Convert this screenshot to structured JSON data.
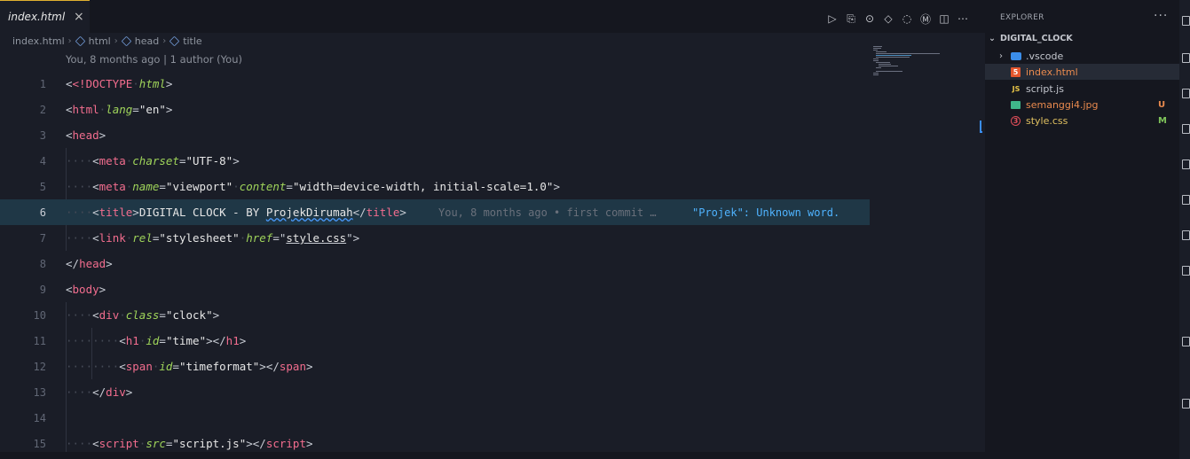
{
  "tab": {
    "label": "index.html",
    "close": "×"
  },
  "actions": [
    "▷",
    "⎘",
    "⊙",
    "◇",
    "◌",
    "Ⓜ",
    "◫",
    "⋯"
  ],
  "breadcrumb": [
    "index.html",
    "html",
    "head",
    "title"
  ],
  "blame_header": "You, 8 months ago | 1 author (You)",
  "lines": [
    {
      "n": "1"
    },
    {
      "n": "2"
    },
    {
      "n": "3"
    },
    {
      "n": "4"
    },
    {
      "n": "5"
    },
    {
      "n": "6"
    },
    {
      "n": "7"
    },
    {
      "n": "8"
    },
    {
      "n": "9"
    },
    {
      "n": "10"
    },
    {
      "n": "11"
    },
    {
      "n": "12"
    },
    {
      "n": "13"
    },
    {
      "n": "14"
    },
    {
      "n": "15"
    }
  ],
  "code": {
    "l1_doctype": "<!DOCTYPE",
    "l1_html": "html",
    "l2_tag": "html",
    "l2_attr": "lang",
    "l2_val": "\"en\"",
    "l3_tag": "head",
    "l4_tag": "meta",
    "l4_attr": "charset",
    "l4_val": "\"UTF-8\"",
    "l5_tag": "meta",
    "l5_attr1": "name",
    "l5_val1": "\"viewport\"",
    "l5_attr2": "content",
    "l5_val2": "\"width=device-width, initial-scale=1.0\"",
    "l6_tag": "title",
    "l6_text1": "DIGITAL CLOCK - BY ",
    "l6_word": "ProjekDirumah",
    "l6_close": "title",
    "l6_blame": "You, 8 months ago • first commit …",
    "l6_spell": "\"Projek\": Unknown word.",
    "l7_tag": "link",
    "l7_attr1": "rel",
    "l7_val1": "\"stylesheet\"",
    "l7_attr2": "href",
    "l7_link": "style.css",
    "l8_tag": "head",
    "l9_tag": "body",
    "l10_tag": "div",
    "l10_attr": "class",
    "l10_val": "\"clock\"",
    "l11_tag": "h1",
    "l11_attr": "id",
    "l11_val": "\"time\"",
    "l11_close": "h1",
    "l12_tag": "span",
    "l12_attr": "id",
    "l12_val": "\"timeformat\"",
    "l12_close": "span",
    "l13_tag": "div",
    "l15_tag": "script",
    "l15_attr": "src",
    "l15_val": "\"script.js\"",
    "l15_close": "script"
  },
  "explorer": {
    "title": "EXPLORER",
    "more": "···",
    "folder": "DIGITAL_CLOCK",
    "files": [
      {
        "name": ".vscode",
        "icon": "vscode-folder-icon",
        "badge": "",
        "color": "#c4c7ce",
        "icon_color": "#3b8eea"
      },
      {
        "name": "index.html",
        "icon": "html5-icon",
        "badge": "",
        "color": "#e98a4e",
        "icon_color": "#e4572e"
      },
      {
        "name": "script.js",
        "icon": "javascript-icon",
        "badge": "",
        "color": "#c4c7ce",
        "icon_color": "#e8c547"
      },
      {
        "name": "semanggi4.jpg",
        "icon": "image-icon",
        "badge": "U",
        "color": "#e98a4e",
        "icon_color": "#3fb68a",
        "badge_color": "#e98a4e"
      },
      {
        "name": "style.css",
        "icon": "css-icon",
        "badge": "M",
        "color": "#e0c060",
        "icon_color": "#e24f5a",
        "badge_color": "#7fc35a"
      }
    ]
  },
  "icons": {
    "folder_chevron": "⌄",
    "subfolder_chevron": "›",
    "html_glyph": "5",
    "js_glyph": "JS",
    "css_glyph": "3"
  }
}
